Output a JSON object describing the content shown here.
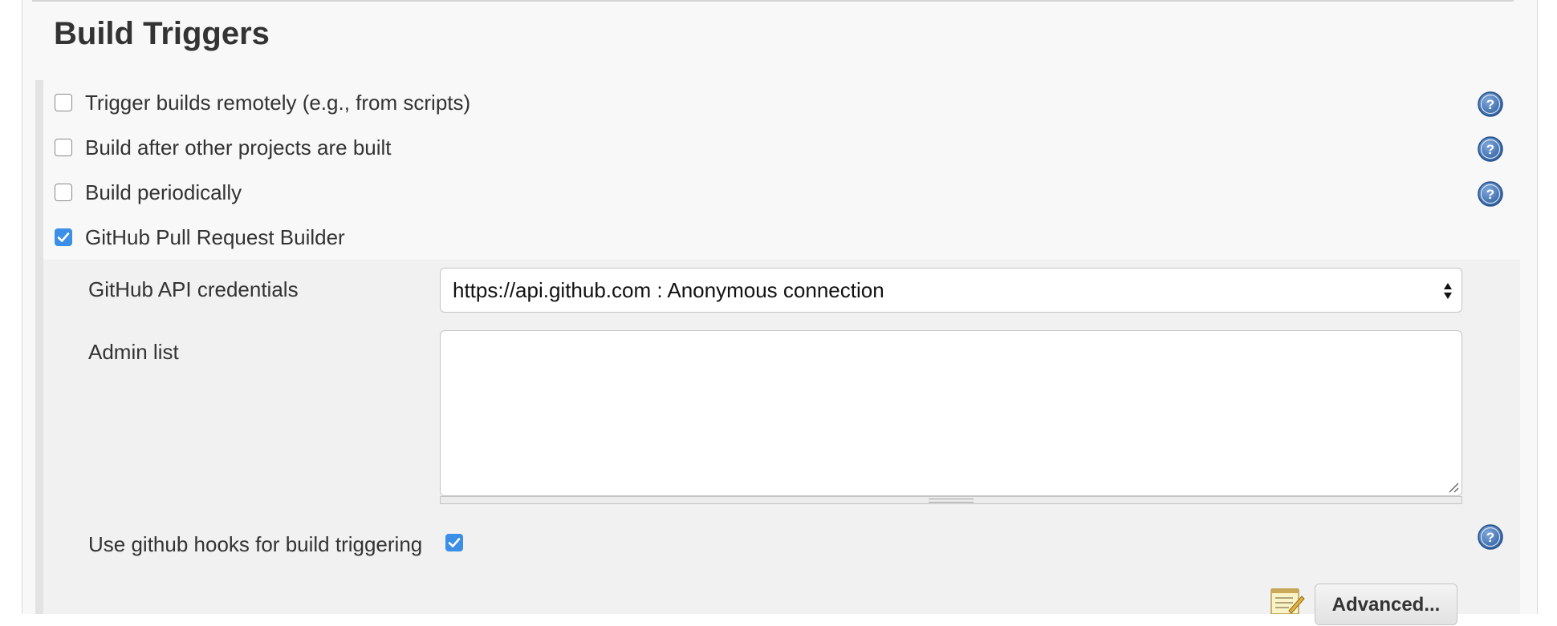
{
  "section": {
    "title": "Build Triggers"
  },
  "triggers": [
    {
      "label": "Trigger builds remotely (e.g., from scripts)",
      "checked": false,
      "has_help": true
    },
    {
      "label": "Build after other projects are built",
      "checked": false,
      "has_help": true
    },
    {
      "label": "Build periodically",
      "checked": false,
      "has_help": true
    },
    {
      "label": "GitHub Pull Request Builder",
      "checked": true,
      "has_help": false
    }
  ],
  "ghprb": {
    "credentials_label": "GitHub API credentials",
    "credentials_value": "https://api.github.com : Anonymous connection",
    "admin_list_label": "Admin list",
    "admin_list_value": "",
    "use_hooks_label": "Use github hooks for build triggering",
    "use_hooks_checked": true,
    "advanced_label": "Advanced..."
  },
  "icons": {
    "help": "help-icon",
    "checkmark": "checkmark-icon",
    "notepad": "notepad-icon",
    "select_arrows": "select-arrows-icon",
    "resize_grip": "resize-grip-icon"
  },
  "colors": {
    "checkbox_checked": "#3b8fe6",
    "help_icon": "#3b6eb0",
    "panel_bg": "#f8f8f8",
    "sub_panel_bg": "#f1f1f1"
  }
}
